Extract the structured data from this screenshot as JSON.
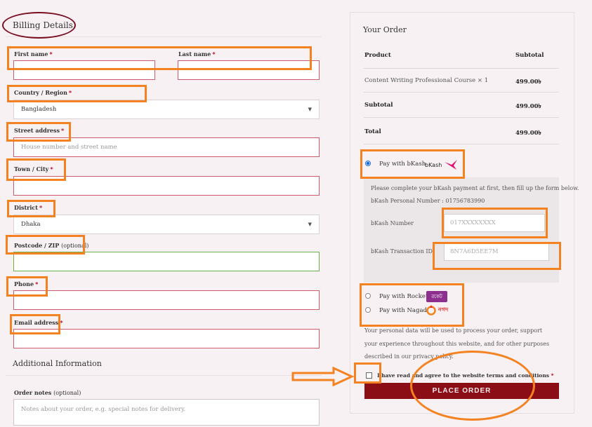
{
  "billing": {
    "title": "Billing Details",
    "first_name_label": "First name",
    "last_name_label": "Last name",
    "country_label": "Country / Region",
    "country_value": "Bangladesh",
    "street_label": "Street address",
    "street_placeholder": "House number and street name",
    "town_label": "Town / City",
    "district_label": "District",
    "district_value": "Dhaka",
    "postcode_label": "Postcode / ZIP",
    "postcode_optional": "(optional)",
    "phone_label": "Phone",
    "email_label": "Email address",
    "required_mark": "*"
  },
  "additional": {
    "title": "Additional Information",
    "notes_label": "Order notes",
    "notes_optional": "(optional)",
    "notes_placeholder": "Notes about your order, e.g. special notes for delivery."
  },
  "order": {
    "title": "Your Order",
    "col_product": "Product",
    "col_subtotal": "Subtotal",
    "item_name": "Content Writing Professional Course",
    "item_qty": "× 1",
    "item_price": "499.00৳",
    "subtotal_label": "Subtotal",
    "subtotal_value": "499.00৳",
    "total_label": "Total",
    "total_value": "499.00৳"
  },
  "payment": {
    "bkash_label": "Pay with bKash",
    "bkash_logo_text": "bKash",
    "bkash_instructions": "Please complete your bKash payment at first, then fill up the form below.",
    "bkash_personal": "bKash Personal Number : 01756783990",
    "bkash_number_label": "bKash Number",
    "bkash_number_placeholder": "017XXXXXXXX",
    "bkash_trx_label": "bKash Transaction ID",
    "bkash_trx_placeholder": "8N7A6D5EE7M",
    "rocket_label": "Pay with Rocket",
    "rocket_logo_text": "রকেট",
    "nagad_label": "Pay with Nagad",
    "nagad_logo_text": "নগদ"
  },
  "privacy": {
    "text": "Your personal data will be used to process your order, support your experience throughout this website, and for other purposes described in our privacy policy."
  },
  "terms": {
    "text": "I have read and agree to the website terms and conditions",
    "required_mark": "*"
  },
  "place_order_label": "PLACE ORDER",
  "colors": {
    "accent": "#8b0d16",
    "annotation": "#f58220",
    "required": "#b3001b"
  }
}
